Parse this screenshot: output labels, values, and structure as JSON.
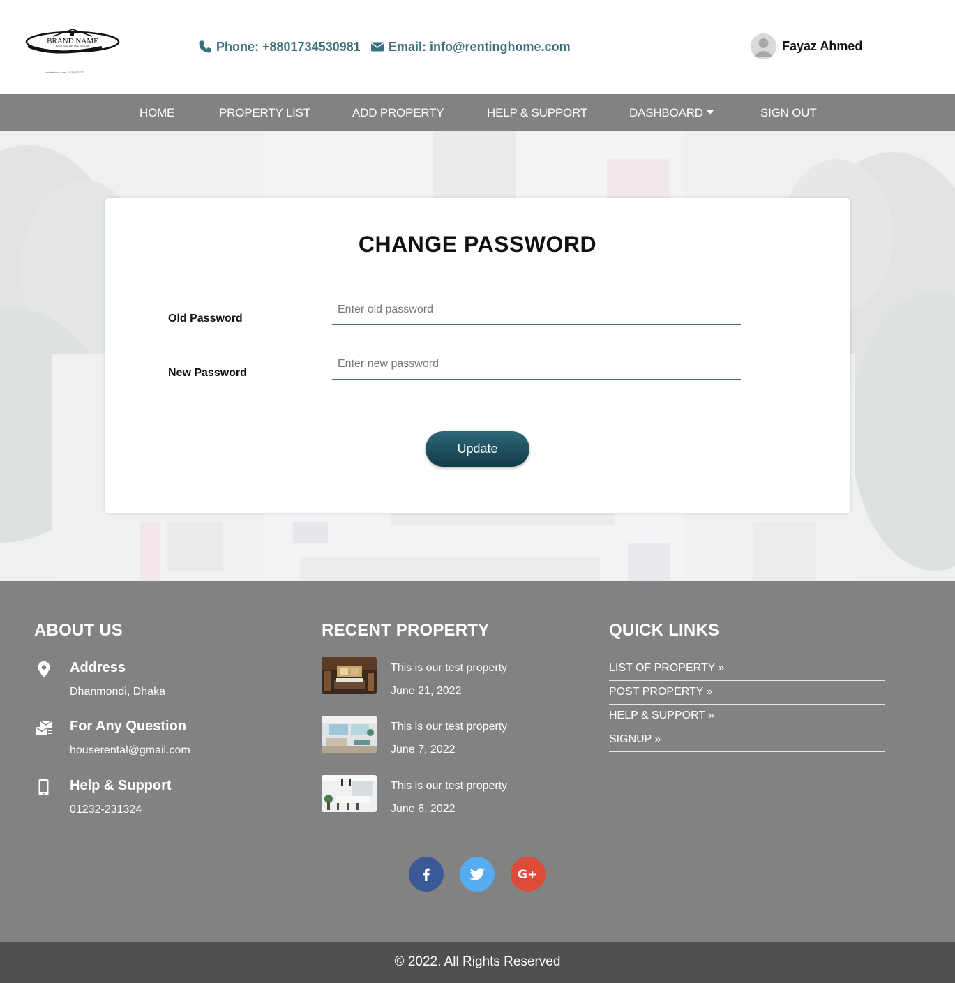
{
  "header": {
    "logo": {
      "brand_text": "BRAND NAME",
      "tagline": "YOUR SLOGAN AND TAGLINE",
      "watermark": "shutterstock.com · 1578335717"
    },
    "phone_label": "Phone: +8801734530981",
    "email_label": "Email: info@rentinghome.com",
    "user_name": "Fayaz Ahmed",
    "accent_color": "#3c6e7d"
  },
  "nav": {
    "items": [
      {
        "label": "HOME"
      },
      {
        "label": "PROPERTY LIST"
      },
      {
        "label": "ADD PROPERTY"
      },
      {
        "label": "HELP & SUPPORT"
      },
      {
        "label": "DASHBOARD"
      },
      {
        "label": "SIGN OUT"
      }
    ],
    "background": "#828282"
  },
  "form": {
    "title": "CHANGE PASSWORD",
    "old_password": {
      "label": "Old Password",
      "placeholder": "Enter old password",
      "value": ""
    },
    "new_password": {
      "label": "New Password",
      "placeholder": "Enter new password",
      "value": ""
    },
    "submit_label": "Update",
    "button_color": "#1f4f5e"
  },
  "footer": {
    "about": {
      "title": "ABOUT US",
      "items": [
        {
          "icon": "location-pin-icon",
          "heading": "Address",
          "value": "Dhanmondi, Dhaka"
        },
        {
          "icon": "mail-exchange-icon",
          "heading": "For Any Question",
          "value": "houserental@gmail.com"
        },
        {
          "icon": "mobile-phone-icon",
          "heading": "Help & Support",
          "value": "01232-231324"
        }
      ]
    },
    "recent": {
      "title": "RECENT PROPERTY",
      "items": [
        {
          "title": "This is our test property",
          "date": "June 21, 2022"
        },
        {
          "title": "This is our test property",
          "date": "June 7, 2022"
        },
        {
          "title": "This is our test property",
          "date": "June 6, 2022"
        }
      ]
    },
    "quick_links": {
      "title": "QUICK LINKS",
      "items": [
        {
          "label": "LIST OF PROPERTY »"
        },
        {
          "label": "POST PROPERTY »"
        },
        {
          "label": "HELP & SUPPORT »"
        },
        {
          "label": "SIGNUP »"
        }
      ]
    },
    "social": [
      {
        "name": "facebook-icon",
        "color": "#3b5998"
      },
      {
        "name": "twitter-icon",
        "color": "#55acee"
      },
      {
        "name": "google-plus-icon",
        "color": "#dd4b39"
      }
    ],
    "copyright": "© 2022. All Rights Reserved"
  }
}
